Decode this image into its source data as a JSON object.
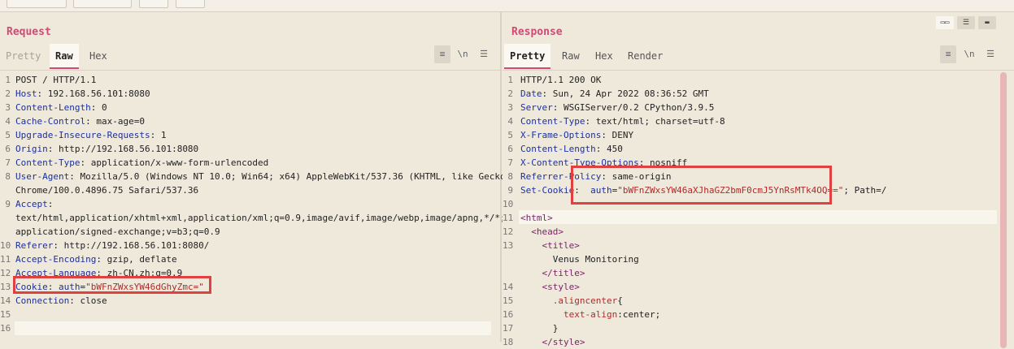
{
  "request": {
    "title": "Request",
    "tabs": [
      "Pretty",
      "Raw",
      "Hex"
    ],
    "tools": {
      "wrap": "≡",
      "newline": "\\n",
      "menu": "☰"
    },
    "lines": [
      {
        "n": "1",
        "parts": [
          {
            "c": "v",
            "t": "POST / HTTP/1.1"
          }
        ]
      },
      {
        "n": "2",
        "parts": [
          {
            "c": "k",
            "t": "Host"
          },
          {
            "c": "v",
            "t": ": 192.168.56.101:8080"
          }
        ]
      },
      {
        "n": "3",
        "parts": [
          {
            "c": "k",
            "t": "Content-Length"
          },
          {
            "c": "v",
            "t": ": 0"
          }
        ]
      },
      {
        "n": "4",
        "parts": [
          {
            "c": "k",
            "t": "Cache-Control"
          },
          {
            "c": "v",
            "t": ": max-age=0"
          }
        ]
      },
      {
        "n": "5",
        "parts": [
          {
            "c": "k",
            "t": "Upgrade-Insecure-Requests"
          },
          {
            "c": "v",
            "t": ": 1"
          }
        ]
      },
      {
        "n": "6",
        "parts": [
          {
            "c": "k",
            "t": "Origin"
          },
          {
            "c": "v",
            "t": ": http://192.168.56.101:8080"
          }
        ]
      },
      {
        "n": "7",
        "parts": [
          {
            "c": "k",
            "t": "Content-Type"
          },
          {
            "c": "v",
            "t": ": application/x-www-form-urlencoded"
          }
        ]
      },
      {
        "n": "8",
        "parts": [
          {
            "c": "k",
            "t": "User-Agent"
          },
          {
            "c": "v",
            "t": ": Mozilla/5.0 (Windows NT 10.0; Win64; x64) AppleWebKit/537.36 (KHTML, like Gecko)"
          }
        ]
      },
      {
        "n": "",
        "parts": [
          {
            "c": "v",
            "t": "Chrome/100.0.4896.75 Safari/537.36"
          }
        ]
      },
      {
        "n": "9",
        "parts": [
          {
            "c": "k",
            "t": "Accept"
          },
          {
            "c": "v",
            "t": ":"
          }
        ]
      },
      {
        "n": "",
        "parts": [
          {
            "c": "v",
            "t": "text/html,application/xhtml+xml,application/xml;q=0.9,image/avif,image/webp,image/apng,*/*;q=0.8,"
          }
        ]
      },
      {
        "n": "",
        "parts": [
          {
            "c": "v",
            "t": "application/signed-exchange;v=b3;q=0.9"
          }
        ]
      },
      {
        "n": "10",
        "parts": [
          {
            "c": "k",
            "t": "Referer"
          },
          {
            "c": "v",
            "t": ": http://192.168.56.101:8080/"
          }
        ]
      },
      {
        "n": "11",
        "parts": [
          {
            "c": "k",
            "t": "Accept-Encoding"
          },
          {
            "c": "v",
            "t": ": gzip, deflate"
          }
        ]
      },
      {
        "n": "12",
        "parts": [
          {
            "c": "k",
            "t": "Accept-Language"
          },
          {
            "c": "v",
            "t": ": zh-CN,zh;q=0.9"
          }
        ]
      },
      {
        "n": "13",
        "parts": [
          {
            "c": "k",
            "t": "Cookie"
          },
          {
            "c": "v",
            "t": ": "
          },
          {
            "c": "k",
            "t": "auth"
          },
          {
            "c": "v",
            "t": "="
          },
          {
            "c": "s",
            "t": "\"bWFnZWxsYW46dGhyZmc=\""
          }
        ]
      },
      {
        "n": "14",
        "parts": [
          {
            "c": "k",
            "t": "Connection"
          },
          {
            "c": "v",
            "t": ": close"
          }
        ]
      },
      {
        "n": "15",
        "parts": []
      },
      {
        "n": "16",
        "parts": []
      }
    ]
  },
  "response": {
    "title": "Response",
    "tabs": [
      "Pretty",
      "Raw",
      "Hex",
      "Render"
    ],
    "tools": {
      "wrap": "≡",
      "newline": "\\n",
      "menu": "☰"
    },
    "view_buttons": [
      "▭▭",
      "☰",
      "▬"
    ],
    "lines": [
      {
        "n": "1",
        "parts": [
          {
            "c": "v",
            "t": "HTTP/1.1 200 OK"
          }
        ]
      },
      {
        "n": "2",
        "parts": [
          {
            "c": "k",
            "t": "Date"
          },
          {
            "c": "v",
            "t": ": Sun, 24 Apr 2022 08:36:52 GMT"
          }
        ]
      },
      {
        "n": "3",
        "parts": [
          {
            "c": "k",
            "t": "Server"
          },
          {
            "c": "v",
            "t": ": WSGIServer/0.2 CPython/3.9.5"
          }
        ]
      },
      {
        "n": "4",
        "parts": [
          {
            "c": "k",
            "t": "Content-Type"
          },
          {
            "c": "v",
            "t": ": text/html; charset=utf-8"
          }
        ]
      },
      {
        "n": "5",
        "parts": [
          {
            "c": "k",
            "t": "X-Frame-Options"
          },
          {
            "c": "v",
            "t": ": DENY"
          }
        ]
      },
      {
        "n": "6",
        "parts": [
          {
            "c": "k",
            "t": "Content-Length"
          },
          {
            "c": "v",
            "t": ": 450"
          }
        ]
      },
      {
        "n": "7",
        "parts": [
          {
            "c": "k",
            "t": "X-Content-Type-Options"
          },
          {
            "c": "v",
            "t": ": nosniff"
          }
        ]
      },
      {
        "n": "8",
        "parts": [
          {
            "c": "k",
            "t": "Referrer-Policy"
          },
          {
            "c": "v",
            "t": ": same-origin"
          }
        ]
      },
      {
        "n": "9",
        "parts": [
          {
            "c": "k",
            "t": "Set-Cookie"
          },
          {
            "c": "v",
            "t": ":  "
          },
          {
            "c": "k",
            "t": "auth"
          },
          {
            "c": "v",
            "t": "="
          },
          {
            "c": "s",
            "t": "\"bWFnZWxsYW46aXJhaGZ2bmF0cmJ5YnRsMTk4OQ==\""
          },
          {
            "c": "v",
            "t": "; Path=/"
          }
        ]
      },
      {
        "n": "10",
        "parts": []
      },
      {
        "n": "11",
        "parts": [
          {
            "c": "t",
            "t": "<html>"
          }
        ]
      },
      {
        "n": "12",
        "parts": [
          {
            "c": "v",
            "t": "  "
          },
          {
            "c": "t",
            "t": "<head>"
          }
        ]
      },
      {
        "n": "13",
        "parts": [
          {
            "c": "v",
            "t": "    "
          },
          {
            "c": "t",
            "t": "<title>"
          }
        ]
      },
      {
        "n": "",
        "parts": [
          {
            "c": "v",
            "t": "      Venus Monitoring"
          }
        ]
      },
      {
        "n": "",
        "parts": [
          {
            "c": "v",
            "t": "    "
          },
          {
            "c": "t",
            "t": "</title>"
          }
        ]
      },
      {
        "n": "14",
        "parts": [
          {
            "c": "v",
            "t": "    "
          },
          {
            "c": "t",
            "t": "<style>"
          }
        ]
      },
      {
        "n": "15",
        "parts": [
          {
            "c": "v",
            "t": "      "
          },
          {
            "c": "s",
            "t": ".aligncenter"
          },
          {
            "c": "v",
            "t": "{"
          }
        ]
      },
      {
        "n": "16",
        "parts": [
          {
            "c": "v",
            "t": "        "
          },
          {
            "c": "s",
            "t": "text-align"
          },
          {
            "c": "v",
            "t": ":center;"
          }
        ]
      },
      {
        "n": "17",
        "parts": [
          {
            "c": "v",
            "t": "      }"
          }
        ]
      },
      {
        "n": "18",
        "parts": [
          {
            "c": "v",
            "t": "    "
          },
          {
            "c": "t",
            "t": "</style>"
          }
        ]
      }
    ]
  }
}
